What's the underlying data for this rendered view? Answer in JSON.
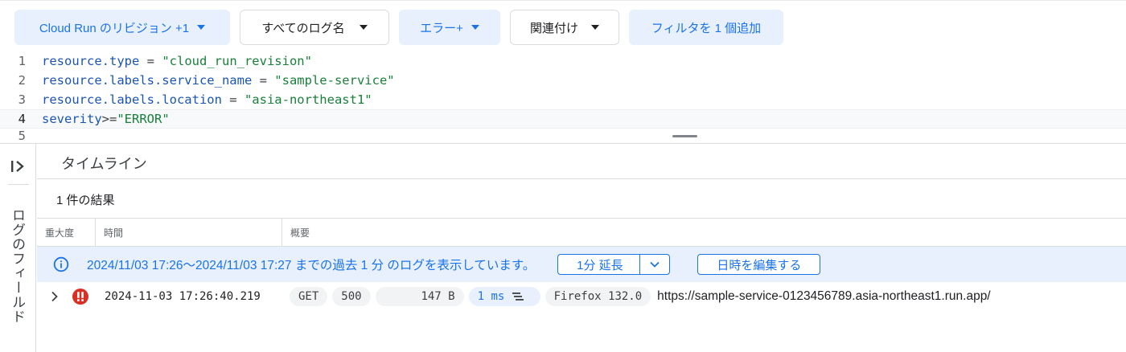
{
  "filters": {
    "revision": "Cloud Run のリビジョン +1",
    "log_names": "すべてのログ名",
    "severity": "エラー+",
    "correlate": "関連付け",
    "add_filter": "フィルタを 1 個追加"
  },
  "query": {
    "line_numbers": [
      "1",
      "2",
      "3",
      "4",
      "5"
    ],
    "lines": [
      {
        "key": "resource.type",
        "op": " = ",
        "value": "\"cloud_run_revision\""
      },
      {
        "key": "resource.labels.service_name",
        "op": " = ",
        "value": "\"sample-service\""
      },
      {
        "key": "resource.labels.location",
        "op": " = ",
        "value": "\"asia-northeast1\""
      },
      {
        "key": "severity",
        "op": ">=",
        "value": "\"ERROR\""
      }
    ]
  },
  "side_panel": {
    "label": "ログのフィールド"
  },
  "timeline": {
    "title": "タイムライン"
  },
  "results": {
    "count": "1 件の結果",
    "columns": {
      "severity": "重大度",
      "time": "時間",
      "summary": "概要"
    }
  },
  "banner": {
    "message": "2024/11/03 17:26〜2024/11/03 17:27 までの過去 1 分 のログを表示しています。",
    "extend_label": "1分 延長",
    "edit_date_label": "日時を編集する"
  },
  "log_entry": {
    "timestamp": "2024-11-03 17:26:40.219",
    "method": "GET",
    "status": "500",
    "size": "147 B",
    "latency": "1 ms",
    "user_agent": "Firefox 132.0",
    "url": "https://sample-service-0123456789.asia-northeast1.run.app/"
  },
  "colors": {
    "accent": "#1a73e8",
    "chip_bg": "#e8f0fe",
    "error": "#d93025",
    "string_token": "#188038",
    "key_token": "#1a55b5"
  },
  "icons": {
    "expand_panel": "expand-panel-icon",
    "info": "info-icon",
    "error": "error-icon",
    "row_expand": "chevron-right-icon",
    "latency_waterfall": "waterfall-icon",
    "dropdown": "chevron-down-icon"
  }
}
